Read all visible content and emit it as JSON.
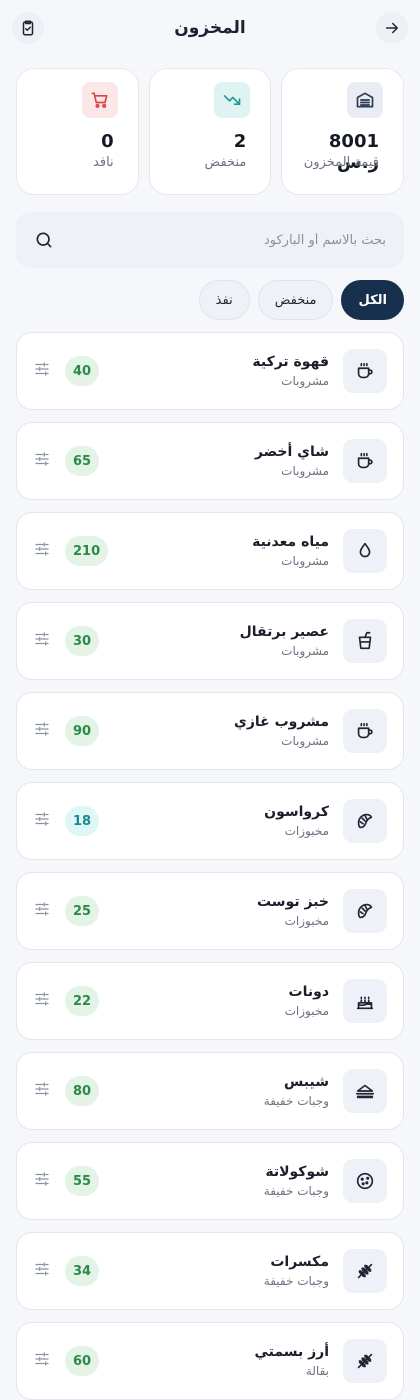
{
  "header": {
    "title": "المخزون"
  },
  "stats": [
    {
      "value": "8001 ر.س",
      "label": "قيمة المخزون",
      "icon": "warehouse-icon",
      "bg": "#e9edf3",
      "color": "#2b3a52"
    },
    {
      "value": "2",
      "label": "منخفض",
      "icon": "trending-down-icon",
      "bg": "#dff3f2",
      "color": "#1f9b8f"
    },
    {
      "value": "0",
      "label": "نافد",
      "icon": "cart-icon",
      "bg": "#fbe7e7",
      "color": "#d94444"
    }
  ],
  "search": {
    "placeholder": "بحث بالاسم أو الباركود"
  },
  "filters": [
    {
      "label": "الكل",
      "active": true
    },
    {
      "label": "منخفض",
      "active": false
    },
    {
      "label": "نفذ",
      "active": false
    }
  ],
  "items": [
    {
      "name": "قهوة تركية",
      "category": "مشروبات",
      "qty": "40",
      "icon": "coffee-cup-icon",
      "low": false
    },
    {
      "name": "شاي أخضر",
      "category": "مشروبات",
      "qty": "65",
      "icon": "coffee-cup-icon",
      "low": false
    },
    {
      "name": "مياه معدنية",
      "category": "مشروبات",
      "qty": "210",
      "icon": "water-drop-icon",
      "low": false
    },
    {
      "name": "عصير برتقال",
      "category": "مشروبات",
      "qty": "30",
      "icon": "cup-straw-icon",
      "low": false
    },
    {
      "name": "مشروب غازي",
      "category": "مشروبات",
      "qty": "90",
      "icon": "coffee-cup-icon",
      "low": false
    },
    {
      "name": "كرواسون",
      "category": "مخبوزات",
      "qty": "18",
      "icon": "croissant-icon",
      "low": true
    },
    {
      "name": "خبز توست",
      "category": "مخبوزات",
      "qty": "25",
      "icon": "croissant-icon",
      "low": false
    },
    {
      "name": "دونات",
      "category": "مخبوزات",
      "qty": "22",
      "icon": "cake-icon",
      "low": false
    },
    {
      "name": "شيبس",
      "category": "وجبات خفيفة",
      "qty": "80",
      "icon": "sandwich-icon",
      "low": false
    },
    {
      "name": "شوكولاتة",
      "category": "وجبات خفيفة",
      "qty": "55",
      "icon": "cookie-icon",
      "low": false
    },
    {
      "name": "مكسرات",
      "category": "وجبات خفيفة",
      "qty": "34",
      "icon": "wheat-icon",
      "low": false
    },
    {
      "name": "أرز بسمتي",
      "category": "بقالة",
      "qty": "60",
      "icon": "wheat-icon",
      "low": false
    }
  ]
}
